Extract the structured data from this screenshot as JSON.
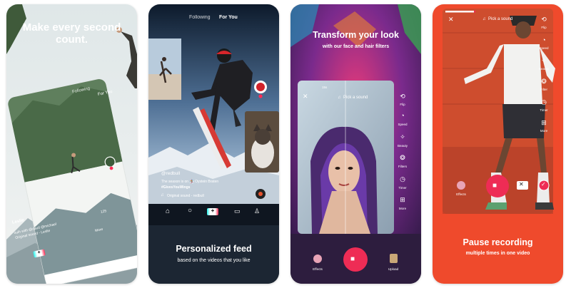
{
  "cards": [
    {
      "headline": "Make every second count.",
      "feed_tabs": {
        "following": "Following",
        "for_you": "For You"
      },
      "side_counts": {
        "likes": "125",
        "more": "More"
      },
      "caption": {
        "user": "Leslie",
        "line1": "ouih with @davd @michael",
        "line2": "Original sound - Leslie"
      }
    },
    {
      "feed_tabs": {
        "following": "Following",
        "for_you": "For You"
      },
      "caption": {
        "user": "@redbull",
        "line1": "The season is on 🏂 Oystein Braten",
        "line2": "#GivesYouWings",
        "sound": "Original sound - redbull"
      },
      "title": "Personalized feed",
      "subtitle": "based on the videos that you like"
    },
    {
      "headline": "Transform your look",
      "subheadline": "with our face and hair filters",
      "camera": {
        "time_badge": "15s",
        "pick_sound": "Pick a sound",
        "tools": [
          "Flip",
          "Speed",
          "Beauty",
          "Filters",
          "Timer",
          "More"
        ],
        "effects_label": "Effects",
        "upload_label": "Upload"
      }
    },
    {
      "camera": {
        "pick_sound": "Pick a sound",
        "tools": [
          "Flip",
          "Speed",
          "Beauty",
          "Filter",
          "Timer",
          "More"
        ],
        "effects_label": "Effects"
      },
      "title": "Pause recording",
      "subtitle": "multiple times in one video"
    }
  ],
  "colors": {
    "record_red": "#ee2c55",
    "tiktok_cyan": "#25f4ee",
    "tiktok_pink": "#fe2c55",
    "card4_bg": "#ef4a2c"
  }
}
